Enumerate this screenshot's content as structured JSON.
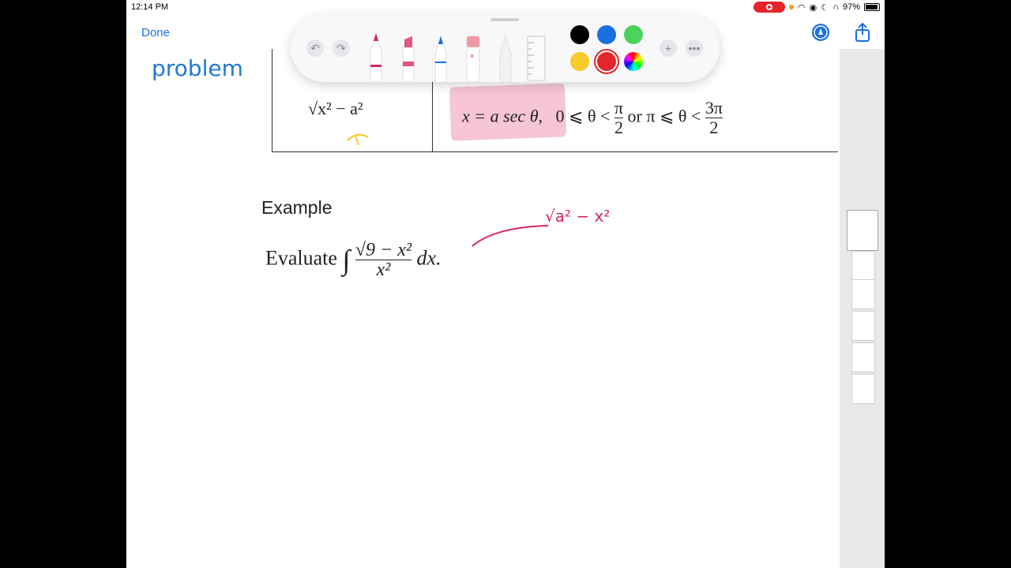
{
  "status": {
    "time": "12:14 PM",
    "battery": "97%"
  },
  "nav": {
    "done_label": "Done"
  },
  "toolbar": {
    "tools": [
      "undo-icon",
      "redo-icon",
      "pen-tool",
      "marker-tool",
      "pencil-tool",
      "eraser-tool",
      "lasso-tool",
      "ruler-tool"
    ],
    "colors": [
      "#000000",
      "#1a6fe0",
      "#4cd35b",
      "#f7c92b",
      "#e5242b",
      "multicolor"
    ],
    "selected_color": "#e5242b"
  },
  "table": {
    "left_expr": "√x² − a²",
    "sub": "x = a sec θ,",
    "range1": "0 ⩽ θ <",
    "pi": "π",
    "two": "2",
    "or": "or",
    "range2": "π ⩽ θ <",
    "threepi": "3π",
    "two2": "2"
  },
  "handwriting": {
    "problem": "problem",
    "annotation": "√a² − x²"
  },
  "content": {
    "example": "Example",
    "evaluate": "Evaluate",
    "numerator": "√9 − x²",
    "denominator": "x²",
    "dx": "dx."
  },
  "sidebar": {
    "page_count": 6
  }
}
